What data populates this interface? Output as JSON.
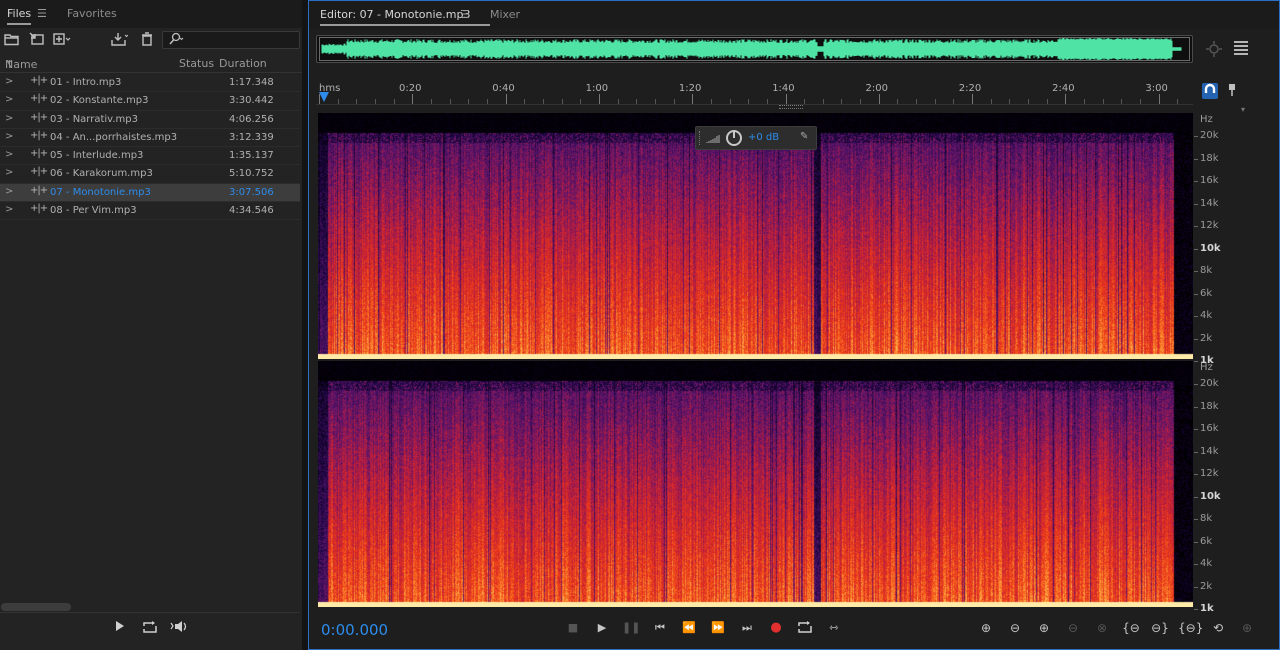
{
  "files_panel": {
    "tabs": [
      {
        "label": "Files"
      },
      {
        "label": "Favorites"
      }
    ],
    "menu_icon": "hamburger-icon",
    "columns": {
      "name": "Name",
      "status": "Status",
      "duration": "Duration"
    },
    "files": [
      {
        "name": "01 - Intro.mp3",
        "duration": "1:17.348",
        "selected": false
      },
      {
        "name": "02 - Konstante.mp3",
        "duration": "3:30.442",
        "selected": false
      },
      {
        "name": "03 - Narrativ.mp3",
        "duration": "4:06.256",
        "selected": false
      },
      {
        "name": "04 - An...porrhaistes.mp3",
        "duration": "3:12.339",
        "selected": false
      },
      {
        "name": "05 - Interlude.mp3",
        "duration": "1:35.137",
        "selected": false
      },
      {
        "name": "06 - Karakorum.mp3",
        "duration": "5:10.752",
        "selected": false
      },
      {
        "name": "07 - Monotonie.mp3",
        "duration": "3:07.506",
        "selected": true
      },
      {
        "name": "08 - Per Vim.mp3",
        "duration": "4:34.546",
        "selected": false
      }
    ]
  },
  "editor": {
    "tabs": [
      {
        "label": "Editor: 07 - Monotonie.mp3"
      },
      {
        "label": "Mixer"
      }
    ],
    "ruler": {
      "unit": "hms",
      "ticks": [
        "0:20",
        "0:40",
        "1:00",
        "1:20",
        "1:40",
        "2:00",
        "2:20",
        "2:40",
        "3:00"
      ]
    },
    "hud": {
      "gain": "+0 dB"
    },
    "freq_scale": {
      "unit": "Hz",
      "labels": [
        "20k",
        "18k",
        "16k",
        "14k",
        "12k",
        "10k",
        "8k",
        "6k",
        "4k",
        "2k",
        "1k"
      ],
      "bold": [
        "10k",
        "1k"
      ]
    },
    "timecode": "0:00.000"
  },
  "colors": {
    "accent": "#2d8ceb",
    "waveform": "#4fe3a6",
    "record": "#e23030",
    "spectral_low": "#ffd27a",
    "spectral_mid": "#e8361a",
    "spectral_high": "#4a1566"
  }
}
